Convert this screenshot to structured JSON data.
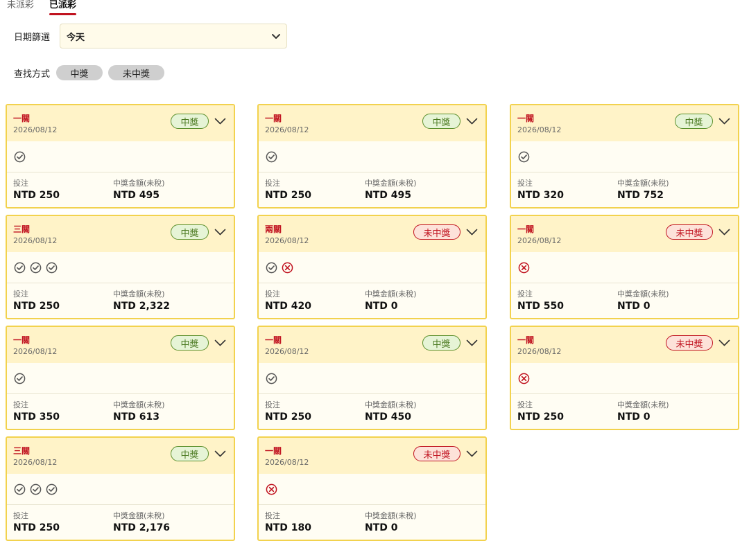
{
  "tabs": [
    "未派彩",
    "已派彩"
  ],
  "filter": {
    "label": "日期篩選",
    "value": "今天"
  },
  "search": {
    "label": "查找方式",
    "options": [
      "中獎",
      "未中獎"
    ]
  },
  "labels": {
    "bet": "投注",
    "prize": "中獎金額(未稅)"
  },
  "colors": {
    "accent": "#c0121f",
    "card_border": "#f2d24e",
    "card_header": "#fff3c8",
    "win": "#5a8f2b",
    "lose": "#c0121f"
  },
  "cards": [
    {
      "title": "一關",
      "date": "2026/08/12",
      "status": "中獎",
      "results": [
        "win"
      ],
      "bet": "NTD 250",
      "prize": "NTD 495"
    },
    {
      "title": "一關",
      "date": "2026/08/12",
      "status": "中獎",
      "results": [
        "win"
      ],
      "bet": "NTD 250",
      "prize": "NTD 495"
    },
    {
      "title": "一關",
      "date": "2026/08/12",
      "status": "中獎",
      "results": [
        "win"
      ],
      "bet": "NTD 320",
      "prize": "NTD 752"
    },
    {
      "title": "三關",
      "date": "2026/08/12",
      "status": "中獎",
      "results": [
        "win",
        "win",
        "win"
      ],
      "bet": "NTD 250",
      "prize": "NTD 2,322"
    },
    {
      "title": "兩關",
      "date": "2026/08/12",
      "status": "未中獎",
      "results": [
        "win",
        "lose"
      ],
      "bet": "NTD 420",
      "prize": "NTD 0"
    },
    {
      "title": "一關",
      "date": "2026/08/12",
      "status": "未中獎",
      "results": [
        "lose"
      ],
      "bet": "NTD 550",
      "prize": "NTD 0"
    },
    {
      "title": "一關",
      "date": "2026/08/12",
      "status": "中獎",
      "results": [
        "win"
      ],
      "bet": "NTD 350",
      "prize": "NTD 613"
    },
    {
      "title": "一關",
      "date": "2026/08/12",
      "status": "中獎",
      "results": [
        "win"
      ],
      "bet": "NTD 250",
      "prize": "NTD 450"
    },
    {
      "title": "一關",
      "date": "2026/08/12",
      "status": "未中獎",
      "results": [
        "lose"
      ],
      "bet": "NTD 250",
      "prize": "NTD 0"
    },
    {
      "title": "三關",
      "date": "2026/08/12",
      "status": "中獎",
      "results": [
        "win",
        "win",
        "win"
      ],
      "bet": "NTD 250",
      "prize": "NTD 2,176"
    },
    {
      "title": "一關",
      "date": "2026/08/12",
      "status": "未中獎",
      "results": [
        "lose"
      ],
      "bet": "NTD 180",
      "prize": "NTD 0"
    }
  ]
}
